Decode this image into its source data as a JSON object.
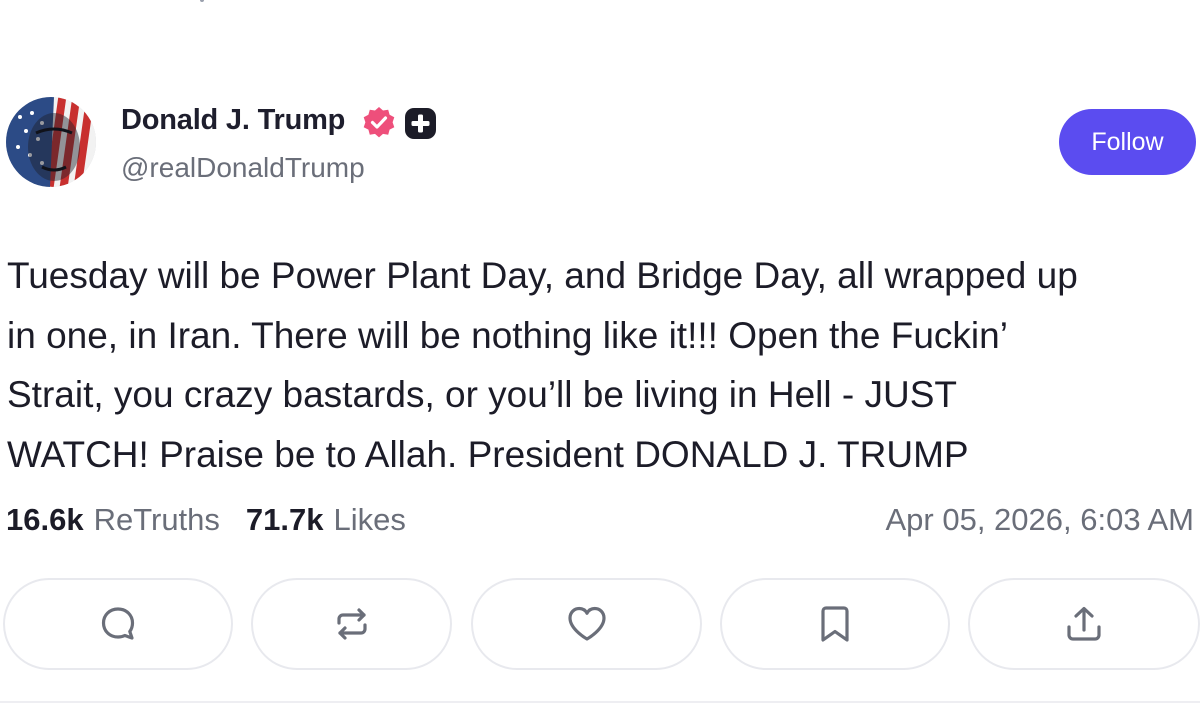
{
  "profile": {
    "display_name": "Donald J. Trump",
    "handle": "@realDonaldTrump",
    "verified_icon": "verified-badge-icon",
    "verified_color": "#ee4f7b",
    "plus_icon": "plus-badge-icon"
  },
  "follow_button": {
    "label": "Follow",
    "color": "#5b4cf0"
  },
  "post": {
    "lines": [
      "Tuesday will be Power Plant Day, and Bridge Day, all wrapped up",
      "in one, in Iran. There will be nothing like it!!! Open the Fuckin’",
      "Strait, you crazy bastards, or you’ll be living in Hell - JUST",
      "WATCH! Praise be to Allah. President DONALD J. TRUMP"
    ]
  },
  "stats": {
    "retruths_count": "16.6k",
    "retruths_label": "ReTruths",
    "likes_count": "71.7k",
    "likes_label": "Likes",
    "timestamp": "Apr 05, 2026, 6:03 AM"
  },
  "actions": [
    {
      "icon": "reply-icon"
    },
    {
      "icon": "retruth-icon"
    },
    {
      "icon": "like-icon"
    },
    {
      "icon": "bookmark-icon"
    },
    {
      "icon": "share-icon"
    }
  ]
}
